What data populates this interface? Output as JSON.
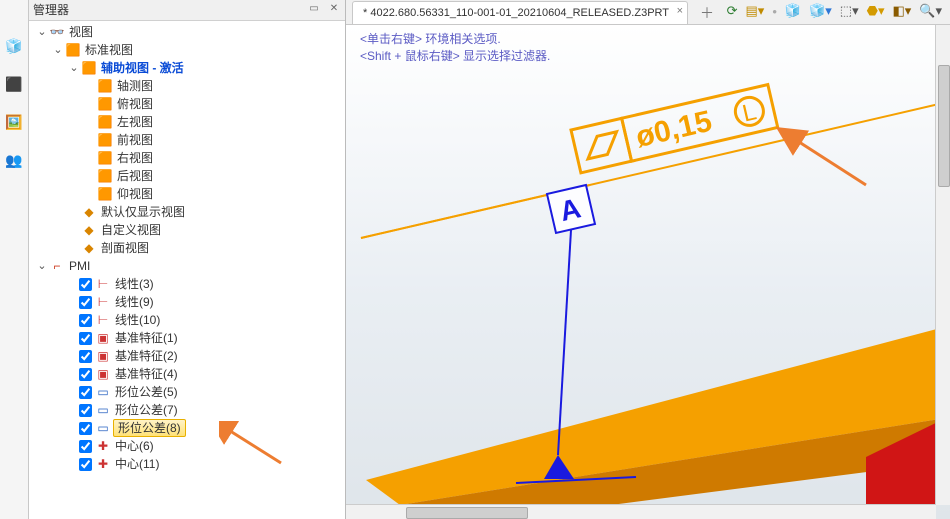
{
  "panel": {
    "title": "管理器"
  },
  "tree": {
    "views_root": "视图",
    "standard_views": "标准视图",
    "aux_active": "辅助视图 - 激活",
    "views": {
      "axon": "轴测图",
      "top": "俯视图",
      "left": "左视图",
      "front": "前视图",
      "right": "右视图",
      "back": "后视图",
      "bottom": "仰视图"
    },
    "default_only": "默认仅显示视图",
    "custom_view": "自定义视图",
    "section_view": "剖面视图",
    "pmi_root": "PMI",
    "pmi": {
      "linear3": "线性(3)",
      "linear9": "线性(9)",
      "linear10": "线性(10)",
      "datum1": "基准特征(1)",
      "datum2": "基准特征(2)",
      "datum4": "基准特征(4)",
      "geo5": "形位公差(5)",
      "geo7": "形位公差(7)",
      "geo8": "形位公差(8)",
      "center6": "中心(6)",
      "center11": "中心(11)"
    }
  },
  "tab": {
    "name": " *  4022.680.56331_110-001-01_20210604_RELEASED.Z3PRT",
    "hint1": "<单击右键> 环境相关选项.",
    "hint2": "<Shift + 鼠标右键> 显示选择过滤器."
  },
  "fcf": {
    "tol": "ø0,15",
    "datum": "A"
  }
}
